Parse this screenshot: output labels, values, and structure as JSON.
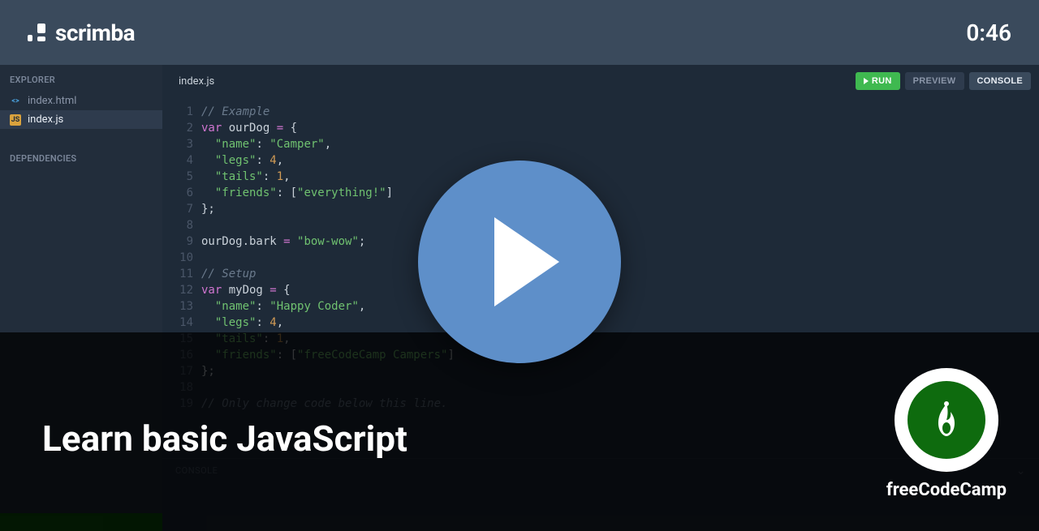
{
  "header": {
    "brand": "scrimba",
    "timestamp": "0:46"
  },
  "sidebar": {
    "explorer_label": "EXPLORER",
    "dependencies_label": "DEPENDENCIES",
    "files": [
      {
        "name": "index.html",
        "type": "html",
        "active": false
      },
      {
        "name": "index.js",
        "type": "js",
        "active": true
      }
    ]
  },
  "editor": {
    "tab_label": "index.js",
    "buttons": {
      "run": "RUN",
      "preview": "PREVIEW",
      "console": "CONSOLE"
    },
    "code_lines": [
      [
        {
          "t": "// Example",
          "c": "comment"
        }
      ],
      [
        {
          "t": "var ",
          "c": "key"
        },
        {
          "t": "ourDog ",
          "c": "var"
        },
        {
          "t": "= ",
          "c": "op"
        },
        {
          "t": "{",
          "c": "punc"
        }
      ],
      [
        {
          "t": "  ",
          "c": "punc"
        },
        {
          "t": "\"name\"",
          "c": "str"
        },
        {
          "t": ": ",
          "c": "punc"
        },
        {
          "t": "\"Camper\"",
          "c": "str"
        },
        {
          "t": ",",
          "c": "punc"
        }
      ],
      [
        {
          "t": "  ",
          "c": "punc"
        },
        {
          "t": "\"legs\"",
          "c": "str"
        },
        {
          "t": ": ",
          "c": "punc"
        },
        {
          "t": "4",
          "c": "num"
        },
        {
          "t": ",",
          "c": "punc"
        }
      ],
      [
        {
          "t": "  ",
          "c": "punc"
        },
        {
          "t": "\"tails\"",
          "c": "str"
        },
        {
          "t": ": ",
          "c": "punc"
        },
        {
          "t": "1",
          "c": "num"
        },
        {
          "t": ",",
          "c": "punc"
        }
      ],
      [
        {
          "t": "  ",
          "c": "punc"
        },
        {
          "t": "\"friends\"",
          "c": "str"
        },
        {
          "t": ": [",
          "c": "punc"
        },
        {
          "t": "\"everything!\"",
          "c": "str"
        },
        {
          "t": "]",
          "c": "punc"
        }
      ],
      [
        {
          "t": "};",
          "c": "punc"
        }
      ],
      [
        {
          "t": "",
          "c": "punc"
        }
      ],
      [
        {
          "t": "ourDog.bark ",
          "c": "var"
        },
        {
          "t": "= ",
          "c": "op"
        },
        {
          "t": "\"bow-wow\"",
          "c": "str"
        },
        {
          "t": ";",
          "c": "punc"
        }
      ],
      [
        {
          "t": "",
          "c": "punc"
        }
      ],
      [
        {
          "t": "// Setup",
          "c": "comment"
        }
      ],
      [
        {
          "t": "var ",
          "c": "key"
        },
        {
          "t": "myDog ",
          "c": "var"
        },
        {
          "t": "= ",
          "c": "op"
        },
        {
          "t": "{",
          "c": "punc"
        }
      ],
      [
        {
          "t": "  ",
          "c": "punc"
        },
        {
          "t": "\"name\"",
          "c": "str"
        },
        {
          "t": ": ",
          "c": "punc"
        },
        {
          "t": "\"Happy Coder\"",
          "c": "str"
        },
        {
          "t": ",",
          "c": "punc"
        }
      ],
      [
        {
          "t": "  ",
          "c": "punc"
        },
        {
          "t": "\"legs\"",
          "c": "str"
        },
        {
          "t": ": ",
          "c": "punc"
        },
        {
          "t": "4",
          "c": "num"
        },
        {
          "t": ",",
          "c": "punc"
        }
      ],
      [
        {
          "t": "  ",
          "c": "punc"
        },
        {
          "t": "\"tails\"",
          "c": "str"
        },
        {
          "t": ": ",
          "c": "punc"
        },
        {
          "t": "1",
          "c": "num"
        },
        {
          "t": ",",
          "c": "punc"
        }
      ],
      [
        {
          "t": "  ",
          "c": "punc"
        },
        {
          "t": "\"friends\"",
          "c": "str"
        },
        {
          "t": ": [",
          "c": "punc"
        },
        {
          "t": "\"freeCodeCamp Campers\"",
          "c": "str"
        },
        {
          "t": "]",
          "c": "punc"
        }
      ],
      [
        {
          "t": "};",
          "c": "punc"
        }
      ],
      [
        {
          "t": "",
          "c": "punc"
        }
      ],
      [
        {
          "t": "// Only change code below this line.",
          "c": "comment"
        }
      ]
    ]
  },
  "console": {
    "label": "CONSOLE"
  },
  "overlay": {
    "lesson_title": "Learn basic JavaScript",
    "attribution": "freeCodeCamp"
  }
}
